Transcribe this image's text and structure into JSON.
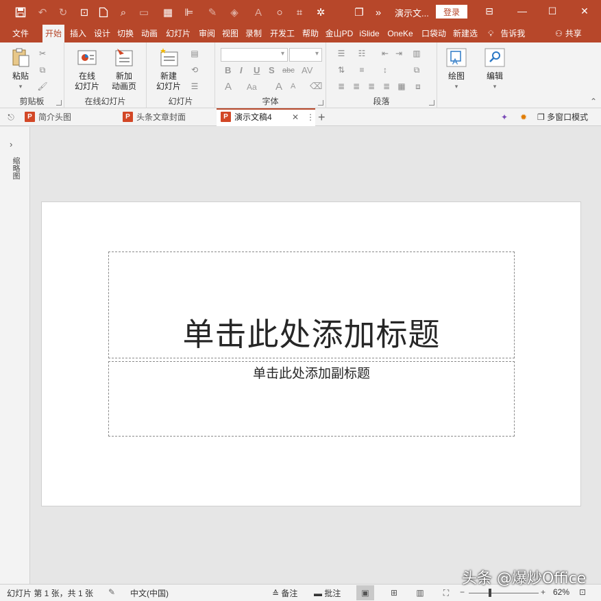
{
  "app": {
    "doc_title": "演示文...",
    "login_label": "登录"
  },
  "ribbon_tabs": [
    {
      "label": "文件"
    },
    {
      "label": "开始"
    },
    {
      "label": "插入"
    },
    {
      "label": "设计"
    },
    {
      "label": "切换"
    },
    {
      "label": "动画"
    },
    {
      "label": "幻灯片"
    },
    {
      "label": "审阅"
    },
    {
      "label": "视图"
    },
    {
      "label": "录制"
    },
    {
      "label": "开发工"
    },
    {
      "label": "帮助"
    },
    {
      "label": "金山PD"
    },
    {
      "label": "iSlide"
    },
    {
      "label": "OneKe"
    },
    {
      "label": "口袋动"
    },
    {
      "label": "新建选"
    }
  ],
  "tell_me": "告诉我",
  "share": "共享",
  "ribbon": {
    "clipboard": {
      "paste": "粘贴",
      "label": "剪贴板"
    },
    "online_slides": {
      "btn1_line1": "在线",
      "btn1_line2": "幻灯片",
      "btn2_line1": "新加",
      "btn2_line2": "动画页",
      "label": "在线幻灯片"
    },
    "slides": {
      "new_line1": "新建",
      "new_line2": "幻灯片",
      "label": "幻灯片"
    },
    "font": {
      "label": "字体",
      "font_name": "",
      "font_size": ""
    },
    "paragraph": {
      "label": "段落"
    },
    "drawing": {
      "label": "绘图"
    },
    "editing": {
      "label": "编辑"
    }
  },
  "doc_tabs": [
    {
      "label": "简介头图"
    },
    {
      "label": "头条文章封面"
    },
    {
      "label": "演示文稿4"
    }
  ],
  "multi_window": "多窗口模式",
  "thumb_pane": {
    "label": "缩略图"
  },
  "slide": {
    "title_placeholder": "单击此处添加标题",
    "subtitle_placeholder": "单击此处添加副标题"
  },
  "status": {
    "slide_info": "幻灯片 第 1 张，共 1 张",
    "language": "中文(中国)",
    "notes": "备注",
    "comments": "批注",
    "zoom": "62%"
  },
  "watermark": "头条 @爆炒Office",
  "colors": {
    "accent": "#b7472a"
  }
}
